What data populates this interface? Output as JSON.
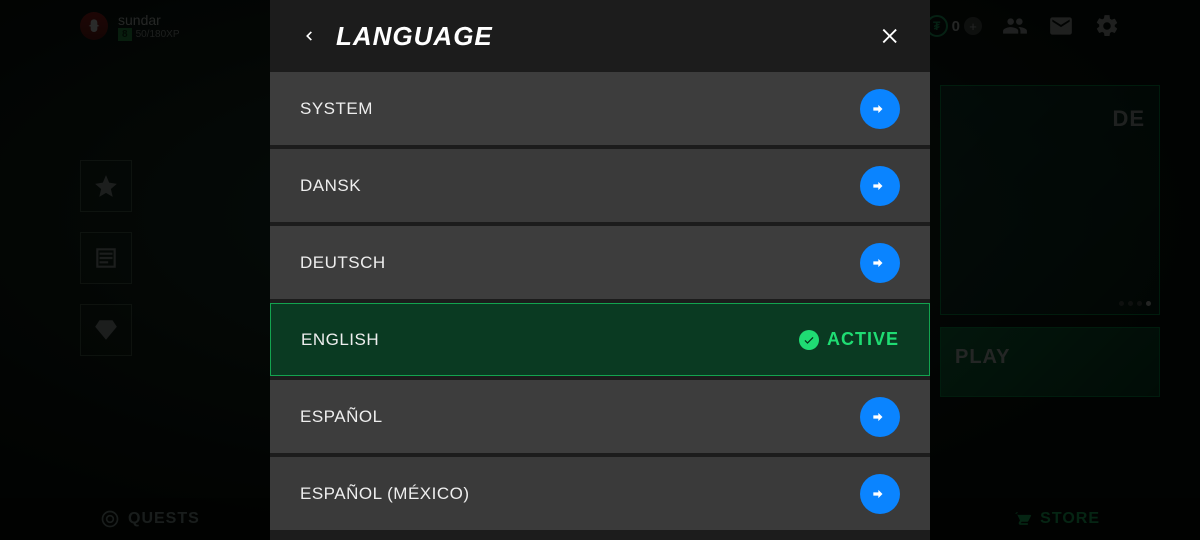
{
  "header": {
    "username": "sundar",
    "level": "8",
    "xp_text": "50/180XP",
    "currency_value": "0"
  },
  "promo": {
    "tile1_text": "DE",
    "tile2_text": "PLAY"
  },
  "bottom": {
    "quests": "QUESTS",
    "store": "STORE"
  },
  "modal": {
    "title": "LANGUAGE",
    "active_label": "ACTIVE",
    "languages": [
      {
        "label": "SYSTEM",
        "active": false
      },
      {
        "label": "DANSK",
        "active": false
      },
      {
        "label": "DEUTSCH",
        "active": false
      },
      {
        "label": "ENGLISH",
        "active": true
      },
      {
        "label": "ESPAÑOL",
        "active": false
      },
      {
        "label": "ESPAÑOL (MÉXICO)",
        "active": false
      }
    ]
  }
}
